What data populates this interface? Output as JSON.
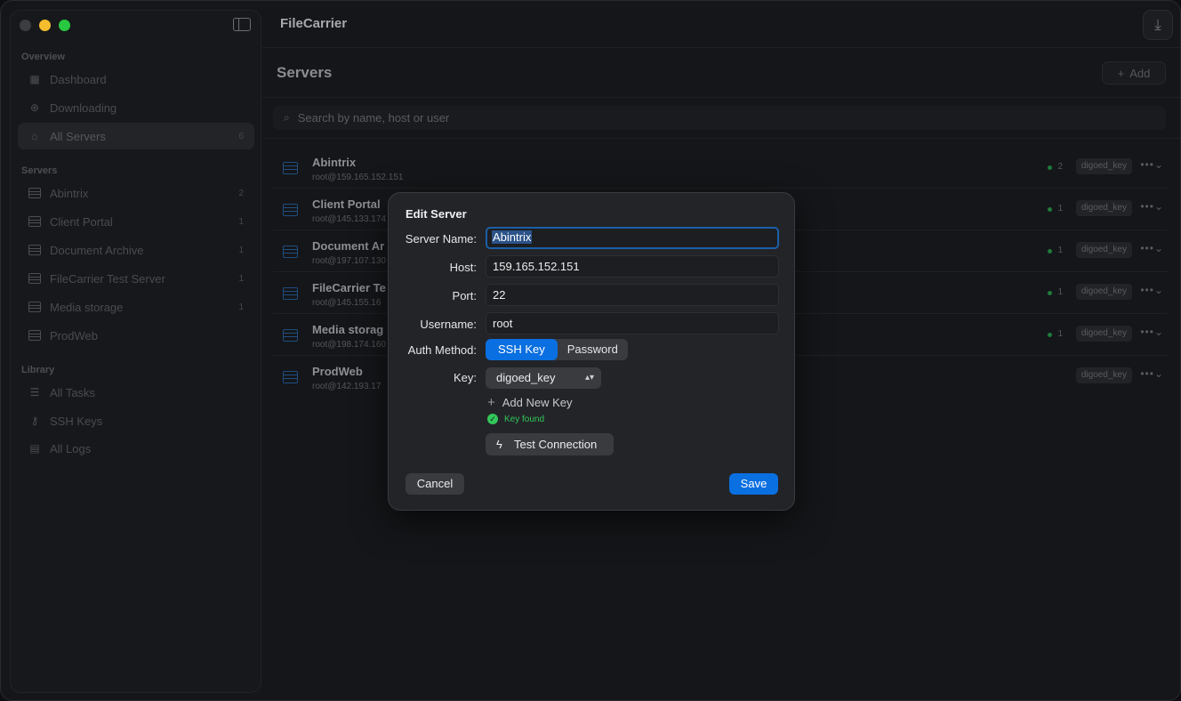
{
  "app": {
    "title": "FileCarrier"
  },
  "sidebar": {
    "sections": [
      {
        "title": "Overview"
      },
      {
        "title": "Servers"
      },
      {
        "title": "Library"
      }
    ],
    "overview_items": [
      {
        "label": "Dashboard",
        "icon": "grid-icon"
      },
      {
        "label": "Downloading",
        "icon": "download-circle-icon"
      },
      {
        "label": "All Servers",
        "icon": "server-stack-icon",
        "count": "6"
      }
    ],
    "server_items": [
      {
        "label": "Abintrix",
        "count": "2"
      },
      {
        "label": "Client Portal",
        "count": "1"
      },
      {
        "label": "Document Archive",
        "count": "1"
      },
      {
        "label": "FileCarrier Test Server",
        "count": "1"
      },
      {
        "label": "Media storage",
        "count": "1"
      },
      {
        "label": "ProdWeb",
        "count": ""
      }
    ],
    "library_items": [
      {
        "label": "All Tasks",
        "icon": "list-icon"
      },
      {
        "label": "SSH Keys",
        "icon": "key-icon"
      },
      {
        "label": "All Logs",
        "icon": "log-icon"
      }
    ]
  },
  "main": {
    "page_title": "Servers",
    "add_label": "Add",
    "search_placeholder": "Search by name, host or user",
    "servers": [
      {
        "name": "Abintrix",
        "addr": "root@159.165.152.151",
        "count": "2",
        "key": "digoed_key",
        "active": true
      },
      {
        "name": "Client Portal",
        "addr": "root@145.133.174",
        "count": "1",
        "key": "digoed_key",
        "active": true
      },
      {
        "name": "Document Ar",
        "addr": "root@197.107.130",
        "count": "1",
        "key": "digoed_key",
        "active": true
      },
      {
        "name": "FileCarrier Te",
        "addr": "root@145.155.16",
        "count": "1",
        "key": "digoed_key",
        "active": true
      },
      {
        "name": "Media storag",
        "addr": "root@198.174.160",
        "count": "1",
        "key": "digoed_key",
        "active": true
      },
      {
        "name": "ProdWeb",
        "addr": "root@142.193.17",
        "count": "",
        "key": "digoed_key",
        "active": false
      }
    ],
    "more_label": "•••"
  },
  "modal": {
    "title": "Edit Server",
    "labels": {
      "server_name": "Server Name:",
      "host": "Host:",
      "port": "Port:",
      "username": "Username:",
      "auth": "Auth Method:",
      "key": "Key:"
    },
    "values": {
      "server_name": "Abintrix",
      "host": "159.165.152.151",
      "port": "22",
      "username": "root"
    },
    "auth_options": [
      "SSH Key",
      "Password"
    ],
    "auth_selected": "SSH Key",
    "key_selected": "digoed_key",
    "add_new_key": "Add New Key",
    "key_status": "Key found",
    "test_connection": "Test Connection",
    "cancel": "Cancel",
    "save": "Save"
  },
  "colors": {
    "accent": "#0a6fe0",
    "success": "#32c759",
    "server_icon": "#1f4d80"
  }
}
